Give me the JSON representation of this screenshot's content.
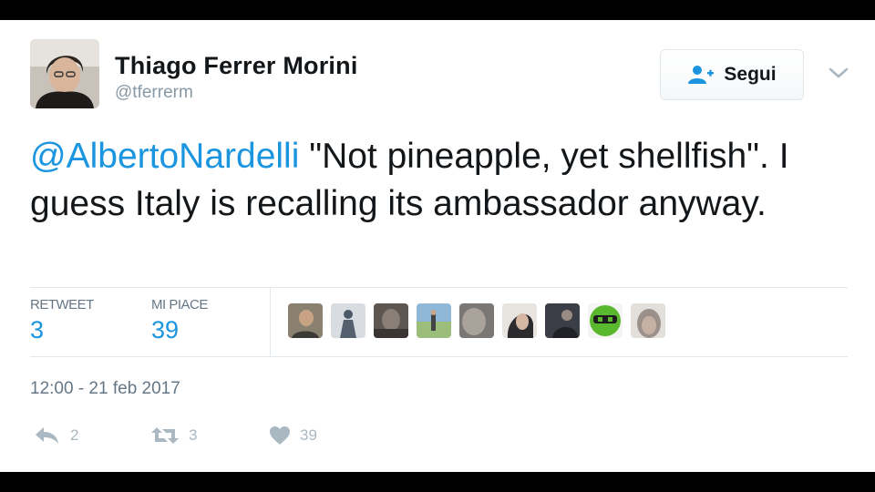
{
  "author": {
    "name": "Thiago Ferrer Morini",
    "handle": "@tferrerm",
    "avatar_icon": "profile-photo"
  },
  "follow_button": {
    "label": "Segui",
    "icon": "add-user-icon"
  },
  "menu": {
    "icon": "chevron-down-icon"
  },
  "tweet": {
    "mention": "@AlbertoNardelli",
    "text_after_mention": " \"Not pineapple, yet shellfish\". I guess Italy is recalling its ambassador anyway."
  },
  "stats": {
    "retweets_label": "RETWEET",
    "retweets_count": "3",
    "likes_label": "MI PIACE",
    "likes_count": "39"
  },
  "likers": [
    {
      "icon": "liker-avatar-1"
    },
    {
      "icon": "liker-avatar-2"
    },
    {
      "icon": "liker-avatar-3"
    },
    {
      "icon": "liker-avatar-4"
    },
    {
      "icon": "liker-avatar-5"
    },
    {
      "icon": "liker-avatar-6"
    },
    {
      "icon": "liker-avatar-7"
    },
    {
      "icon": "liker-avatar-8"
    },
    {
      "icon": "liker-avatar-9"
    }
  ],
  "timestamp": "12:00 - 21 feb 2017",
  "actions": {
    "reply_count": "2",
    "retweet_count": "3",
    "like_count": "39"
  },
  "colors": {
    "link": "#1b95e0",
    "text": "#14171a",
    "muted": "#657786",
    "action_icon": "#aab8c2",
    "background_frame": "#000000"
  }
}
